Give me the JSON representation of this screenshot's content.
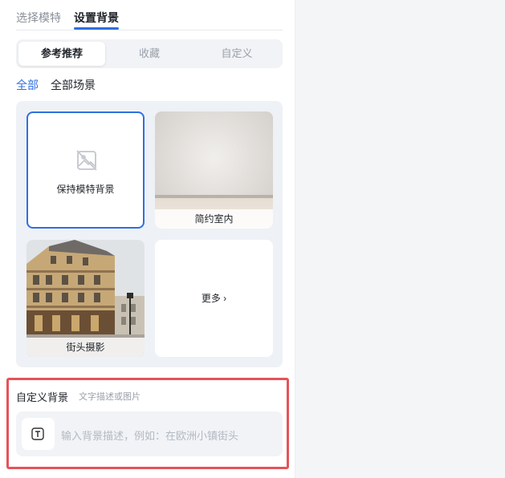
{
  "tabs": {
    "items": [
      "选择模特",
      "设置背景"
    ],
    "active": "设置背景"
  },
  "segments": {
    "items": [
      "参考推荐",
      "收藏",
      "自定义"
    ],
    "active": "参考推荐"
  },
  "filters": {
    "items": [
      "全部",
      "全部场景"
    ],
    "active": "全部"
  },
  "cards": [
    {
      "label": "保持模特背景",
      "icon": "no-image-icon",
      "selected": true
    },
    {
      "label": "简约室内"
    },
    {
      "label": "街头摄影"
    },
    {
      "label": "更多"
    }
  ],
  "custom_background": {
    "title": "自定义背景",
    "subtitle": "文字描述或图片",
    "placeholder": "输入背景描述，例如：在欧洲小镇街头",
    "button_icon": "text-icon"
  },
  "colors": {
    "accent": "#2f6fe0",
    "highlight_border": "#e5535a"
  }
}
